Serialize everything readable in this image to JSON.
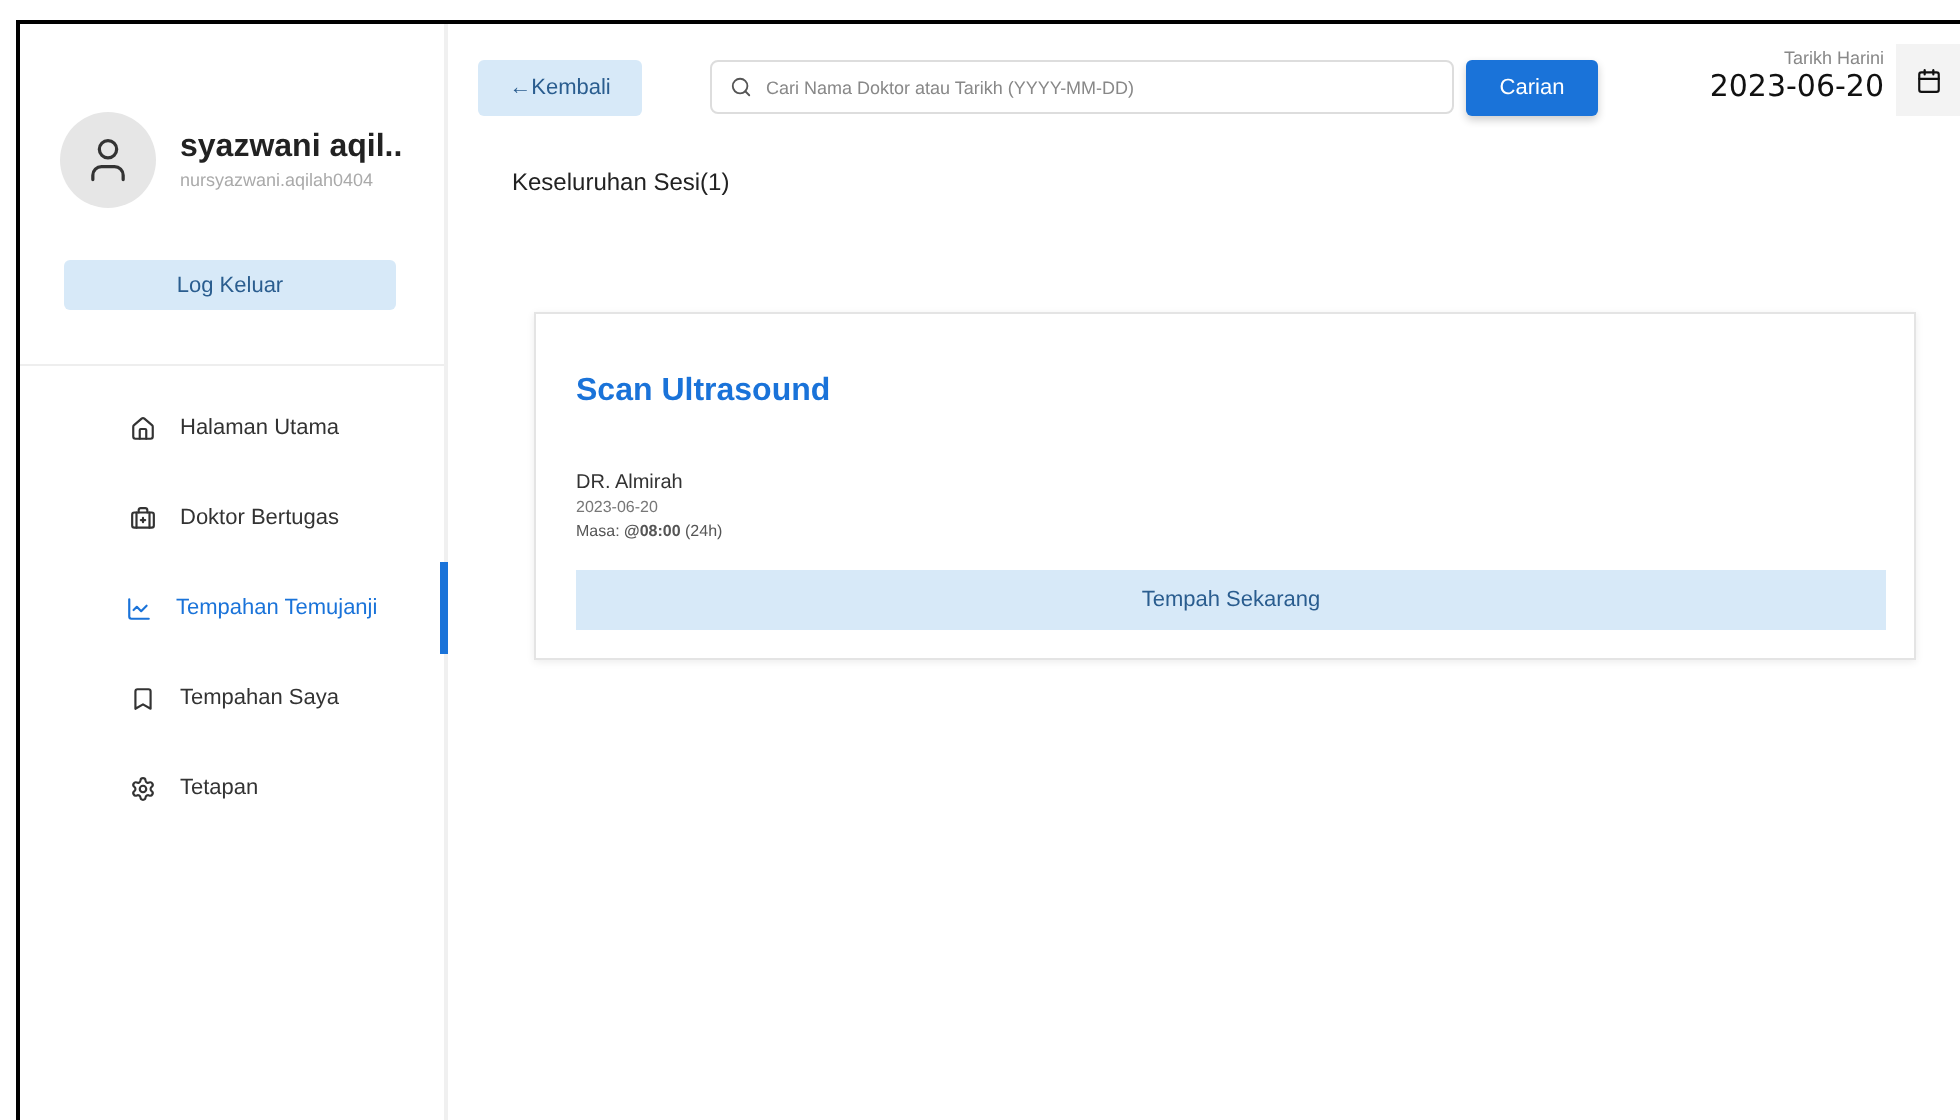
{
  "user": {
    "name": "syazwani aqil..",
    "email": "nursyazwani.aqilah0404"
  },
  "logout": "Log Keluar",
  "nav": [
    {
      "label": "Halaman Utama",
      "selected": false
    },
    {
      "label": "Doktor Bertugas",
      "selected": false
    },
    {
      "label": "Tempahan Temujanji",
      "selected": true
    },
    {
      "label": "Tempahan Saya",
      "selected": false
    },
    {
      "label": "Tetapan",
      "selected": false
    }
  ],
  "back": "←Kembali",
  "search": {
    "placeholder": "Cari Nama Doktor atau Tarikh (YYYY-MM-DD)",
    "button": "Carian"
  },
  "today": {
    "label": "Tarikh Harini",
    "date": "2023-06-20"
  },
  "heading": "Keseluruhan Sesi(1)",
  "sessions": [
    {
      "title": "Scan Ultrasound",
      "doctor": "DR. Almirah",
      "date": "2023-06-20",
      "time": "Masa: **@08:00** (24h)",
      "button": "Tempah Sekarang"
    }
  ]
}
